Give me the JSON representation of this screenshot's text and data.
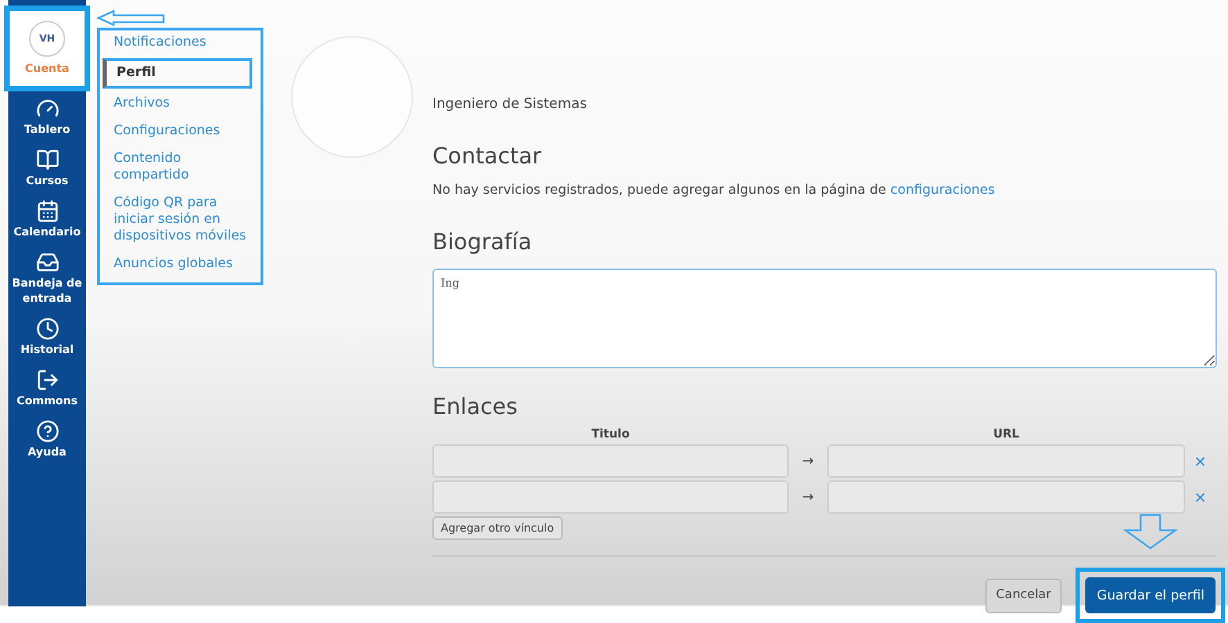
{
  "nav": [
    {
      "kind": "account",
      "initials": "VH",
      "label": "Cuenta",
      "selected": true
    },
    {
      "kind": "dashboard",
      "label": "Tablero",
      "selected": false
    },
    {
      "kind": "courses",
      "label": "Cursos",
      "selected": false
    },
    {
      "kind": "calendar",
      "label": "Calendario",
      "selected": false
    },
    {
      "kind": "inbox",
      "label": "Bandeja de entrada",
      "selected": false
    },
    {
      "kind": "history",
      "label": "Historial",
      "selected": false
    },
    {
      "kind": "commons",
      "label": "Commons",
      "selected": false
    },
    {
      "kind": "help",
      "label": "Ayuda",
      "selected": false
    }
  ],
  "account_menu": [
    {
      "label": "Notificaciones",
      "selected": false
    },
    {
      "label": "Perfil",
      "selected": true
    },
    {
      "label": "Archivos",
      "selected": false
    },
    {
      "label": "Configuraciones",
      "selected": false
    },
    {
      "label": "Contenido compartido",
      "selected": false
    },
    {
      "label": "Código QR para iniciar sesión en dispositivos móviles",
      "selected": false
    },
    {
      "label": "Anuncios globales",
      "selected": false
    }
  ],
  "profile": {
    "title": "Ingeniero de Sistemas"
  },
  "contact": {
    "heading": "Contactar",
    "text": "No hay servicios registrados, puede agregar algunos en la página de",
    "link": "configuraciones"
  },
  "bio": {
    "heading": "Biografía",
    "value": "Ing"
  },
  "links": {
    "heading": "Enlaces",
    "columns": [
      "Titulo",
      "URL"
    ],
    "rows": [
      {
        "arrow": "→",
        "remove": "×"
      },
      {
        "arrow": "→",
        "remove": "×"
      }
    ],
    "add_button": "Agregar otro vínculo"
  },
  "actions": {
    "cancel": "Cancelar",
    "save": "Guardar el perfil"
  }
}
